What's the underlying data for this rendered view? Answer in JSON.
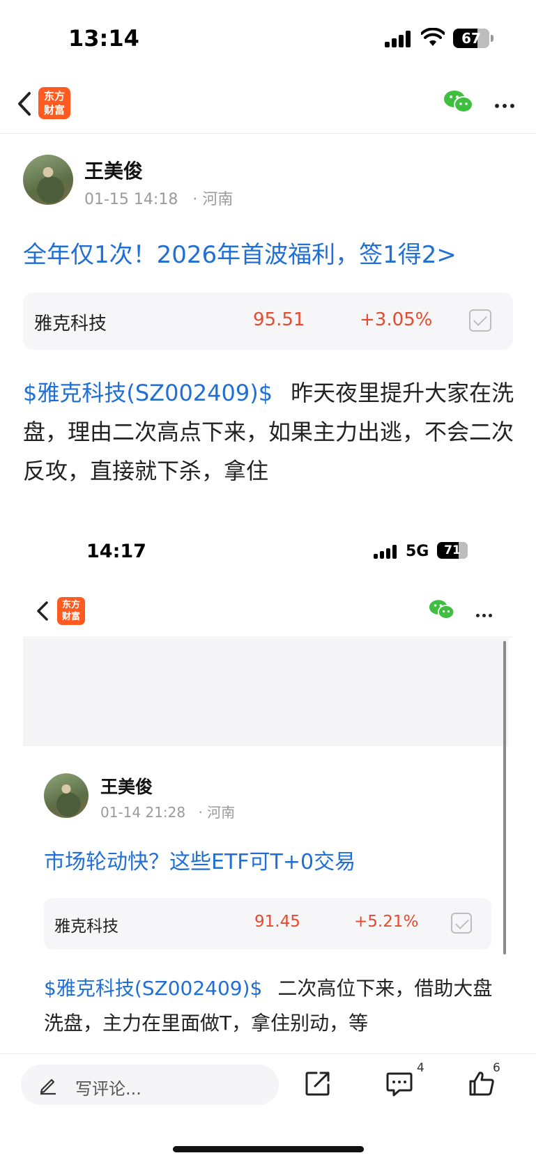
{
  "status_bar": {
    "time": "13:14",
    "battery": "67",
    "battery_level": 67
  },
  "nav": {
    "logo_line1": "东方",
    "logo_line2": "财富"
  },
  "post": {
    "author": "王美俊",
    "date": "01-15 14:18",
    "location": "· 河南",
    "promo_link": "全年仅1次！2026年首波福利，签1得2>",
    "stock": {
      "name": "雅克科技",
      "price": "95.51",
      "change": "+3.05%"
    },
    "body_tag": "$雅克科技(SZ002409)$",
    "body_text": "昨天夜里提升大家在洗盘，理由二次高点下来，如果主力出逃，不会二次反攻，直接就下杀，拿住"
  },
  "embedded": {
    "time": "14:17",
    "network": "5G",
    "battery": "71",
    "battery_level": 71,
    "logo_line1": "东方",
    "logo_line2": "财富",
    "author": "王美俊",
    "date": "01-14 21:28",
    "location": "· 河南",
    "promo_link": "市场轮动快？这些ETF可T+0交易",
    "stock": {
      "name": "雅克科技",
      "price": "91.45",
      "change": "+5.21%"
    },
    "body_tag": "$雅克科技(SZ002409)$",
    "body_text": "二次高位下来，借助大盘洗盘，主力在里面做T，拿住别动，等"
  },
  "bottom_bar": {
    "comment_placeholder": "写评论...",
    "comments_count": "4",
    "likes_count": "6"
  },
  "colors": {
    "link": "#1f6fd6",
    "price_up": "#e64a2e",
    "brand": "#ff5a1f",
    "wechat": "#3fbf3f"
  }
}
